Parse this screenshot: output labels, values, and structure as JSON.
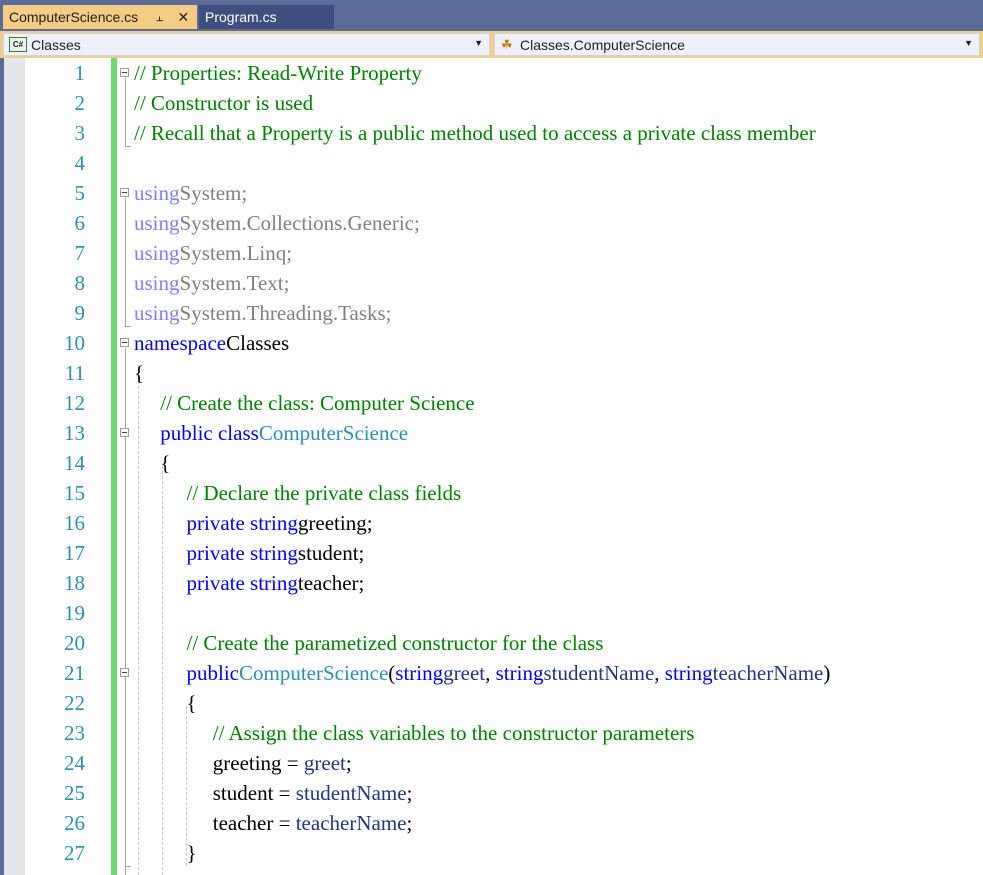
{
  "tabs": [
    {
      "label": "ComputerScience.cs",
      "active": true,
      "pin_icon": "pin-icon",
      "close_icon": "close-icon"
    },
    {
      "label": "Program.cs",
      "active": false
    }
  ],
  "navbar": {
    "project_dropdown": {
      "value": "Classes",
      "icon": "csharp-project-icon"
    },
    "type_dropdown": {
      "value": "Classes.ComputerScience",
      "icon": "class-icon"
    }
  },
  "colors": {
    "comment": "#008000",
    "keyword": "#0000ff",
    "type": "#2b91af",
    "using_keyword": "#7f7fff",
    "line_number": "#2b91af",
    "change_bar": "#6cdb6c",
    "active_tab": "#f5cc84"
  },
  "code_lines": [
    {
      "n": "1",
      "tokens": [
        [
          "cm",
          "// Properties: Read-Write Property"
        ]
      ]
    },
    {
      "n": "2",
      "tokens": [
        [
          "cm",
          "// Constructor is used"
        ]
      ]
    },
    {
      "n": "3",
      "tokens": [
        [
          "cm",
          "// Recall that a Property is a public method used to access a private class member"
        ]
      ]
    },
    {
      "n": "4",
      "tokens": []
    },
    {
      "n": "5",
      "tokens": [
        [
          "us",
          "using"
        ],
        [
          "gr",
          " System;"
        ]
      ]
    },
    {
      "n": "6",
      "tokens": [
        [
          "us",
          "using"
        ],
        [
          "gr",
          " System.Collections.Generic;"
        ]
      ]
    },
    {
      "n": "7",
      "tokens": [
        [
          "us",
          "using"
        ],
        [
          "gr",
          " System.Linq;"
        ]
      ]
    },
    {
      "n": "8",
      "tokens": [
        [
          "us",
          "using"
        ],
        [
          "gr",
          " System.Text;"
        ]
      ]
    },
    {
      "n": "9",
      "tokens": [
        [
          "us",
          "using"
        ],
        [
          "gr",
          " System.Threading.Tasks;"
        ]
      ]
    },
    {
      "n": "10",
      "tokens": [
        [
          "kw",
          "namespace"
        ],
        [
          "",
          ". Classes"
        ]
      ]
    },
    {
      "n": "11",
      "tokens": [
        [
          "",
          "{"
        ]
      ]
    },
    {
      "n": "12",
      "tokens": [
        [
          "",
          "  "
        ],
        [
          "cm",
          "// Create the class: Computer Science"
        ]
      ]
    },
    {
      "n": "13",
      "tokens": [
        [
          "",
          "  "
        ],
        [
          "kw",
          "public class"
        ],
        [
          "",
          " "
        ],
        [
          "ty",
          "ComputerScience"
        ]
      ]
    },
    {
      "n": "14",
      "tokens": [
        [
          "",
          "  {"
        ]
      ]
    },
    {
      "n": "15",
      "tokens": [
        [
          "",
          "    "
        ],
        [
          "cm",
          "// Declare the private class fields"
        ]
      ]
    },
    {
      "n": "16",
      "tokens": [
        [
          "",
          "    "
        ],
        [
          "kw",
          "private string"
        ],
        [
          "",
          " greeting;"
        ]
      ]
    },
    {
      "n": "17",
      "tokens": [
        [
          "",
          "    "
        ],
        [
          "kw",
          "private string"
        ],
        [
          "",
          " student;"
        ]
      ]
    },
    {
      "n": "18",
      "tokens": [
        [
          "",
          "    "
        ],
        [
          "kw",
          "private string"
        ],
        [
          "",
          " teacher;"
        ]
      ]
    },
    {
      "n": "19",
      "tokens": []
    },
    {
      "n": "20",
      "tokens": [
        [
          "",
          "    "
        ],
        [
          "cm",
          "// Create the parametized constructor for the class"
        ]
      ]
    },
    {
      "n": "21",
      "tokens": [
        [
          "",
          "    "
        ],
        [
          "kw",
          "public"
        ],
        [
          "",
          " "
        ],
        [
          "ty",
          "ComputerScience"
        ],
        [
          "",
          "("
        ],
        [
          "kw",
          "string"
        ],
        [
          "pr",
          " greet"
        ],
        [
          "",
          ", "
        ],
        [
          "kw",
          "string"
        ],
        [
          "pr",
          " studentName"
        ],
        [
          "",
          ", "
        ],
        [
          "kw",
          "string"
        ],
        [
          "pr",
          " teacherName"
        ],
        [
          "",
          ")"
        ]
      ]
    },
    {
      "n": "22",
      "tokens": [
        [
          "",
          "    {"
        ]
      ]
    },
    {
      "n": "23",
      "tokens": [
        [
          "",
          "      "
        ],
        [
          "cm",
          "// Assign the class variables to the constructor parameters"
        ]
      ]
    },
    {
      "n": "24",
      "tokens": [
        [
          "",
          "      greeting = "
        ],
        [
          "pr",
          "greet"
        ],
        [
          "",
          ";"
        ]
      ]
    },
    {
      "n": "25",
      "tokens": [
        [
          "",
          "      student = "
        ],
        [
          "pr",
          "studentName"
        ],
        [
          "",
          ";"
        ]
      ]
    },
    {
      "n": "26",
      "tokens": [
        [
          "",
          "      teacher = "
        ],
        [
          "pr",
          "teacherName"
        ],
        [
          "",
          ";"
        ]
      ]
    },
    {
      "n": "27",
      "tokens": [
        [
          "",
          "    }"
        ]
      ]
    }
  ]
}
